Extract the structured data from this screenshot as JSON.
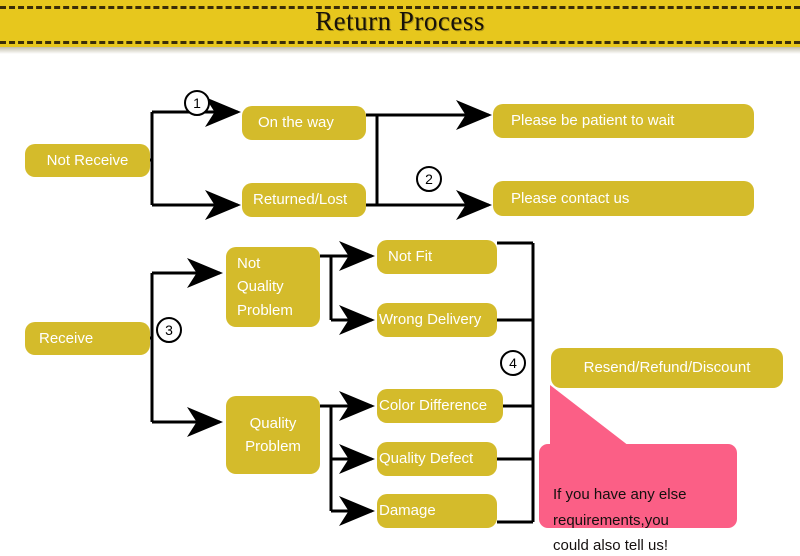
{
  "header": {
    "title": "Return Process",
    "background_color": "#e7c71d",
    "stitch_color": "#3a2d08"
  },
  "theme": {
    "node_color": "#d4bb2b",
    "node_text_color": "#ffffff",
    "callout_color": "#fb5f86",
    "connector_color": "#000000",
    "canvas_color": "#ffffff"
  },
  "flow": {
    "nodes": [
      {
        "id": "not-receive",
        "label": "Not Receive"
      },
      {
        "id": "on-the-way",
        "label": "On the way"
      },
      {
        "id": "returned-lost",
        "label": "Returned/Lost"
      },
      {
        "id": "please-wait",
        "label": "Please be patient to wait"
      },
      {
        "id": "please-contact",
        "label": "Please contact us"
      },
      {
        "id": "receive",
        "label": "Receive"
      },
      {
        "id": "not-quality-problem",
        "label": "Not\nQuality\nProblem"
      },
      {
        "id": "quality-problem",
        "label": "Quality\nProblem"
      },
      {
        "id": "not-fit",
        "label": "Not Fit"
      },
      {
        "id": "wrong-delivery",
        "label": "Wrong Delivery"
      },
      {
        "id": "color-difference",
        "label": "Color Difference"
      },
      {
        "id": "quality-defect",
        "label": "Quality Defect"
      },
      {
        "id": "damage",
        "label": "Damage"
      },
      {
        "id": "resend-refund-discount",
        "label": "Resend/Refund/Discount"
      }
    ],
    "markers": [
      {
        "id": "marker-1",
        "label": "1"
      },
      {
        "id": "marker-2",
        "label": "2"
      },
      {
        "id": "marker-3",
        "label": "3"
      },
      {
        "id": "marker-4",
        "label": "4"
      }
    ],
    "callout": {
      "text": "If you have any else\nrequirements,you\ncould also tell us!"
    }
  }
}
